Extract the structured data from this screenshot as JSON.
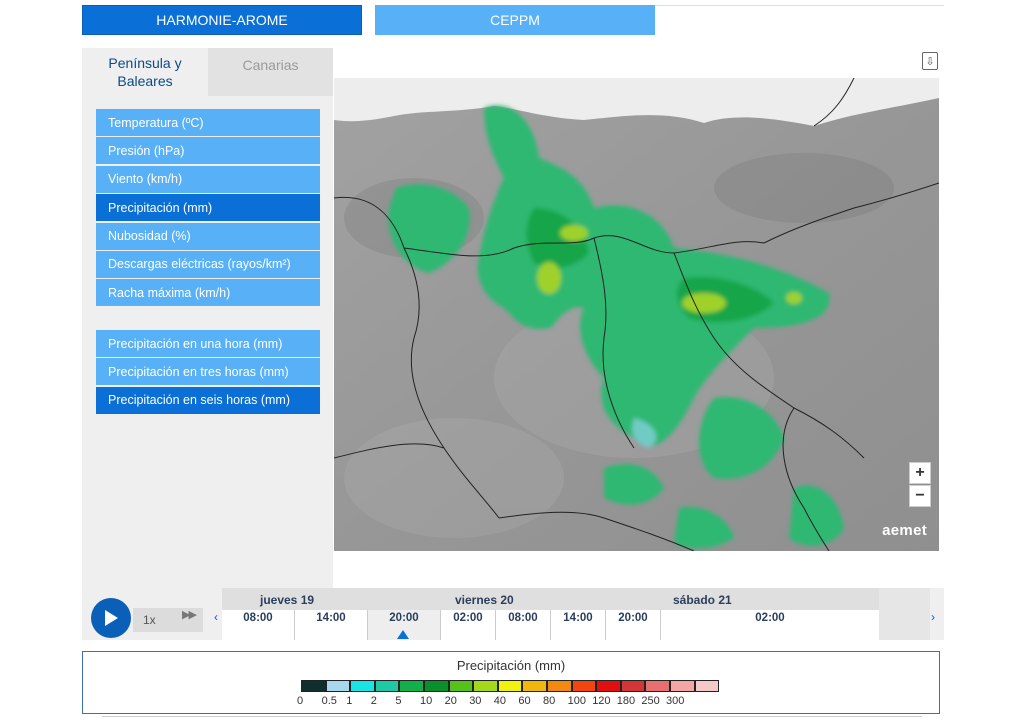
{
  "models": {
    "primary": "HARMONIE-AROME",
    "secondary": "CEPPM"
  },
  "regions": {
    "active": "Península y Baleares",
    "inactive": "Canarias"
  },
  "variables": [
    {
      "label": "Temperatura (ºC)",
      "selected": false
    },
    {
      "label": "Presión (hPa)",
      "selected": false
    },
    {
      "label": "Viento (km/h)",
      "selected": false
    },
    {
      "label": "Precipitación (mm)",
      "selected": true
    },
    {
      "label": "Nubosidad (%)",
      "selected": false
    },
    {
      "label": "Descargas eléctricas (rayos/km²)",
      "selected": false
    },
    {
      "label": "Racha máxima (km/h)",
      "selected": false
    }
  ],
  "precip_options": [
    {
      "label": "Precipitación en una hora (mm)",
      "selected": false
    },
    {
      "label": "Precipitación en tres horas (mm)",
      "selected": false
    },
    {
      "label": "Precipitación en seis horas (mm)",
      "selected": true
    }
  ],
  "map": {
    "zoom_in": "+",
    "zoom_out": "−",
    "brand": "aemet",
    "download_icon": "download-icon"
  },
  "timeline": {
    "speed": "1x",
    "days": [
      "jueves 19",
      "viernes 20",
      "sábado 21"
    ],
    "hours": [
      "08:00",
      "14:00",
      "20:00",
      "02:00",
      "08:00",
      "14:00",
      "20:00",
      "02:00"
    ],
    "current_hour": "20:00",
    "prev_arrow": "‹",
    "next_arrow": "›"
  },
  "legend": {
    "title": "Precipitación (mm)",
    "colors": [
      "#0f2f2f",
      "#a8d8ee",
      "#19e3e3",
      "#1ec9a6",
      "#12b04a",
      "#0a8f2a",
      "#55c21b",
      "#a3d81c",
      "#f2f20f",
      "#f2b70f",
      "#f28a0f",
      "#f2450f",
      "#e01010",
      "#d23737",
      "#e86f6f",
      "#f4a6a6",
      "#f6c8c8"
    ],
    "values": [
      "0",
      "0.5",
      "1",
      "2",
      "5",
      "10",
      "20",
      "30",
      "40",
      "60",
      "80",
      "100",
      "120",
      "180",
      "250",
      "300"
    ]
  }
}
